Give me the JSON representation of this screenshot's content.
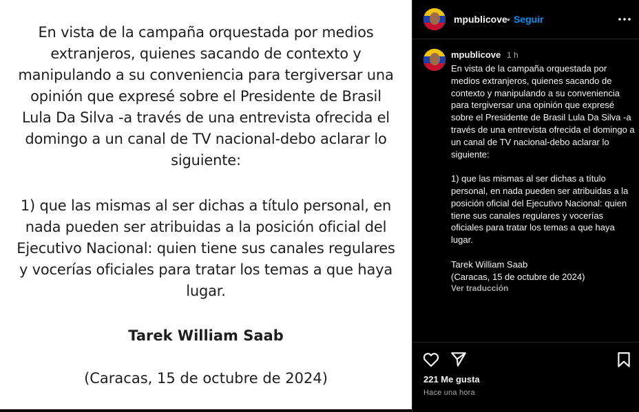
{
  "image": {
    "paragraph1": "En vista de la campaña orquestada por medios extranjeros, quienes sacando de contexto  y manipulando a su conveniencia para tergiversar una opinión que expresé sobre el Presidente de Brasil Lula Da Silva -a través de una entrevista ofrecida el domingo a un canal de TV nacional-debo aclarar lo siguiente:",
    "paragraph2": "1)  que las mismas al ser dichas a título personal, en nada pueden ser atribuidas a la posición oficial del Ejecutivo Nacional: quien tiene sus canales regulares y vocerías oficiales para tratar los temas a que haya lugar.",
    "signature": "Tarek William Saab",
    "date": "(Caracas, 15 de octubre de 2024)"
  },
  "header": {
    "username": "mpublicove",
    "separator": "•",
    "follow_label": "Seguir"
  },
  "caption": {
    "username": "mpublicove",
    "time": "1 h",
    "text": "En vista de la campaña orquestada por medios extranjeros, quienes sacando de contexto y manipulando a su conveniencia para tergiversar una opinión que expresé sobre el Presidente de Brasil Lula Da Silva -a través de una entrevista ofrecida el domingo a un canal de TV nacional-debo aclarar lo siguiente:\n\n1) que las mismas al ser dichas a título personal, en nada pueden ser atribuidas a la posición oficial del Ejecutivo Nacional: quien tiene sus canales regulares y vocerías oficiales para tratar los temas a que haya lugar.\n\nTarek William Saab\n(Caracas, 15 de octubre de 2024)",
    "see_translation": "Ver traducción"
  },
  "footer": {
    "likes": "221 Me gusta",
    "time_ago": "Hace una hora"
  },
  "icons": {
    "more": "more-options-icon",
    "like": "heart-icon",
    "share": "send-icon",
    "save": "bookmark-icon"
  },
  "colors": {
    "background": "#000000",
    "image_background": "#ffffff",
    "follow_blue": "#0095f6",
    "secondary_text": "#a8a8a8"
  }
}
